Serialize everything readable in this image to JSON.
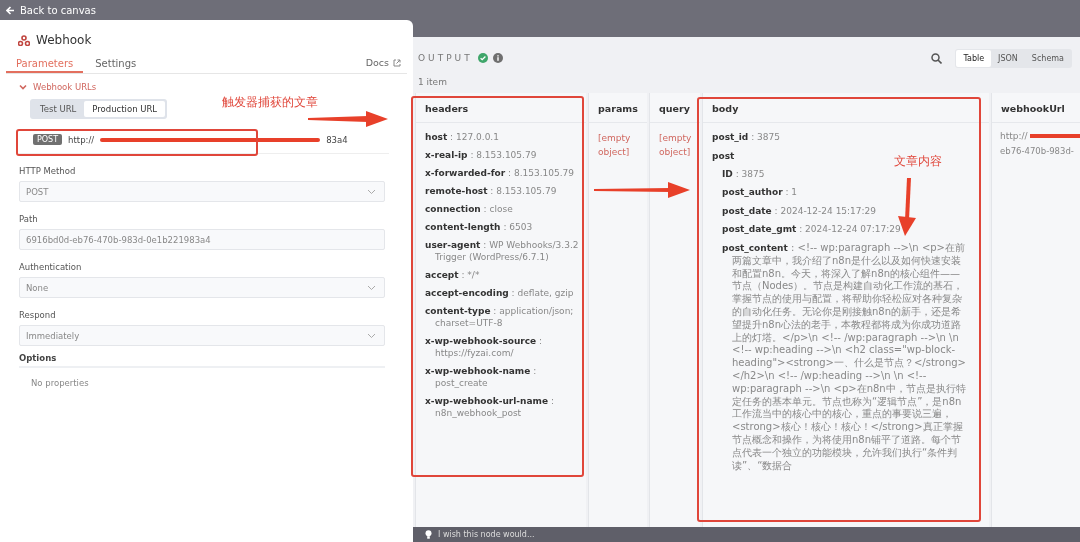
{
  "top_bar": {
    "back_link": "Back to canvas"
  },
  "node_panel": {
    "title": "Webhook",
    "tabs": [
      {
        "label": "Parameters",
        "selected": true
      },
      {
        "label": "Settings",
        "selected": false
      }
    ],
    "docs_link": "Docs",
    "webhook_urls": {
      "label": "Webhook URLs",
      "expanded": true,
      "toggle": [
        {
          "label": "Test URL",
          "selected": false
        },
        {
          "label": "Production URL",
          "selected": true
        }
      ],
      "method_badge": "POST",
      "url_start": "http://",
      "url_end": "83a4"
    },
    "fields": [
      {
        "label": "HTTP Method",
        "value": "POST",
        "kind": "select"
      },
      {
        "label": "Path",
        "value": "6916bd0d-eb76-470b-983d-0e1b221983a4",
        "kind": "input"
      },
      {
        "label": "Authentication",
        "value": "None",
        "kind": "select"
      },
      {
        "label": "Respond",
        "value": "Immediately",
        "kind": "select"
      }
    ],
    "options": {
      "label": "Options",
      "empty_text": "No properties"
    }
  },
  "output": {
    "title": "OUTPUT",
    "item_count": "1 item",
    "view_tabs": [
      {
        "label": "Table",
        "selected": true
      },
      {
        "label": "JSON",
        "selected": false
      },
      {
        "label": "Schema",
        "selected": false
      }
    ],
    "columns": [
      {
        "heading": "headers",
        "kind": "object",
        "entries": [
          {
            "key": "host",
            "value": ": 127.0.0.1"
          },
          {
            "key": "x-real-ip",
            "value": ": 8.153.105.79"
          },
          {
            "key": "x-forwarded-for",
            "value": ": 8.153.105.79"
          },
          {
            "key": "remote-host",
            "value": ": 8.153.105.79"
          },
          {
            "key": "connection",
            "value": ": close"
          },
          {
            "key": "content-length",
            "value": ": 6503"
          },
          {
            "key": "user-agent",
            "value": ": WP Webhooks/3.3.2 Trigger (WordPress/6.7.1)"
          },
          {
            "key": "accept",
            "value": ": */*"
          },
          {
            "key": "accept-encoding",
            "value": ": deflate, gzip"
          },
          {
            "key": "content-type",
            "value": ": application/json; charset=UTF-8"
          },
          {
            "key": "x-wp-webhook-source",
            "value": ": https://fyzai.com/"
          },
          {
            "key": "x-wp-webhook-name",
            "value": ": post_create"
          },
          {
            "key": "x-wp-webhook-url-name",
            "value": ": n8n_webhook_post"
          }
        ]
      },
      {
        "heading": "params",
        "kind": "empty",
        "text": "[empty object]"
      },
      {
        "heading": "query",
        "kind": "empty",
        "text": "[empty object]"
      },
      {
        "heading": "body",
        "kind": "object",
        "entries": [
          {
            "key": "post_id",
            "value": ": 3875"
          },
          {
            "key": "post",
            "children": [
              {
                "key": "ID",
                "value": ": 3875"
              },
              {
                "key": "post_author",
                "value": ": 1"
              },
              {
                "key": "post_date",
                "value": ": 2024-12-24 15:17:29"
              },
              {
                "key": "post_date_gmt",
                "value": ": 2024-12-24 07:17:29"
              },
              {
                "key": "post_content",
                "value": ": <!-- wp:paragraph -->\\n <p>在前两篇文章中，我介绍了n8n是什么以及如何快速安装和配置n8n。今天，将深入了解n8n的核心组件——节点（Nodes）。节点是构建自动化工作流的基石，掌握节点的使用与配置，将帮助你轻松应对各种复杂的自动化任务。无论你是刚接触n8n的新手，还是希望提升n8n心法的老手，本教程都将成为你成功道路上的灯塔。</p>\\n <!-- /wp:paragraph -->\\n \\n <!-- wp:heading -->\\n <h2 class=\"wp-block-heading\"><strong>一、什么是节点？</strong></h2>\\n <!-- /wp:heading -->\\n \\n <!-- wp:paragraph -->\\n <p>在n8n中，节点是执行特定任务的基本单元。节点也称为“逻辑节点”，是n8n工作流当中的核心中的核心，重点的事要说三遍，<strong>核心！核心！核心！</strong>真正掌握节点概念和操作，为将使用n8n铺平了道路。每个节点代表一个独立的功能模块，允许我们执行“条件判读”、“数据合"
              }
            ]
          }
        ]
      },
      {
        "heading": "webhookUrl",
        "kind": "url",
        "url_start": "http://",
        "url_end": "eb76-470b-983d-"
      }
    ]
  },
  "feedback_bar": {
    "text": "I wish this node would..."
  },
  "annotations": [
    {
      "kind": "label",
      "text": "触发器捕获的文章"
    },
    {
      "kind": "label",
      "text": "文章内容"
    }
  ]
}
